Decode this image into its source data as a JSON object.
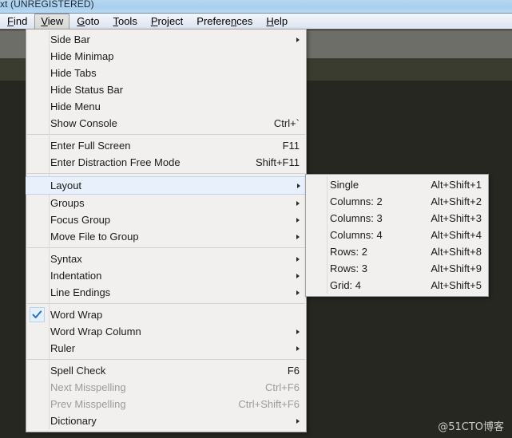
{
  "window": {
    "title": "xt (UNREGISTERED)"
  },
  "menubar": {
    "items": [
      {
        "label": "Find",
        "mnemonic": "F",
        "active": false
      },
      {
        "label": "View",
        "mnemonic": "V",
        "active": true
      },
      {
        "label": "Goto",
        "mnemonic": "G",
        "active": false
      },
      {
        "label": "Tools",
        "mnemonic": "T",
        "active": false
      },
      {
        "label": "Project",
        "mnemonic": "P",
        "active": false
      },
      {
        "label": "Preferences",
        "mnemonic": "n",
        "active": false
      },
      {
        "label": "Help",
        "mnemonic": "H",
        "active": false
      }
    ]
  },
  "view_menu": {
    "groups": [
      {
        "items": [
          {
            "label": "Side Bar",
            "shortcut": "",
            "submenu": true,
            "disabled": false,
            "checked": false,
            "highlighted": false
          },
          {
            "label": "Hide Minimap",
            "shortcut": "",
            "submenu": false,
            "disabled": false,
            "checked": false,
            "highlighted": false
          },
          {
            "label": "Hide Tabs",
            "shortcut": "",
            "submenu": false,
            "disabled": false,
            "checked": false,
            "highlighted": false
          },
          {
            "label": "Hide Status Bar",
            "shortcut": "",
            "submenu": false,
            "disabled": false,
            "checked": false,
            "highlighted": false
          },
          {
            "label": "Hide Menu",
            "shortcut": "",
            "submenu": false,
            "disabled": false,
            "checked": false,
            "highlighted": false
          },
          {
            "label": "Show Console",
            "shortcut": "Ctrl+`",
            "submenu": false,
            "disabled": false,
            "checked": false,
            "highlighted": false
          }
        ]
      },
      {
        "items": [
          {
            "label": "Enter Full Screen",
            "shortcut": "F11",
            "submenu": false,
            "disabled": false,
            "checked": false,
            "highlighted": false
          },
          {
            "label": "Enter Distraction Free Mode",
            "shortcut": "Shift+F11",
            "submenu": false,
            "disabled": false,
            "checked": false,
            "highlighted": false
          }
        ]
      },
      {
        "items": [
          {
            "label": "Layout",
            "shortcut": "",
            "submenu": true,
            "disabled": false,
            "checked": false,
            "highlighted": true
          },
          {
            "label": "Groups",
            "shortcut": "",
            "submenu": true,
            "disabled": false,
            "checked": false,
            "highlighted": false
          },
          {
            "label": "Focus Group",
            "shortcut": "",
            "submenu": true,
            "disabled": false,
            "checked": false,
            "highlighted": false
          },
          {
            "label": "Move File to Group",
            "shortcut": "",
            "submenu": true,
            "disabled": false,
            "checked": false,
            "highlighted": false
          }
        ]
      },
      {
        "items": [
          {
            "label": "Syntax",
            "shortcut": "",
            "submenu": true,
            "disabled": false,
            "checked": false,
            "highlighted": false
          },
          {
            "label": "Indentation",
            "shortcut": "",
            "submenu": true,
            "disabled": false,
            "checked": false,
            "highlighted": false
          },
          {
            "label": "Line Endings",
            "shortcut": "",
            "submenu": true,
            "disabled": false,
            "checked": false,
            "highlighted": false
          }
        ]
      },
      {
        "items": [
          {
            "label": "Word Wrap",
            "shortcut": "",
            "submenu": false,
            "disabled": false,
            "checked": true,
            "highlighted": false
          },
          {
            "label": "Word Wrap Column",
            "shortcut": "",
            "submenu": true,
            "disabled": false,
            "checked": false,
            "highlighted": false
          },
          {
            "label": "Ruler",
            "shortcut": "",
            "submenu": true,
            "disabled": false,
            "checked": false,
            "highlighted": false
          }
        ]
      },
      {
        "items": [
          {
            "label": "Spell Check",
            "shortcut": "F6",
            "submenu": false,
            "disabled": false,
            "checked": false,
            "highlighted": false
          },
          {
            "label": "Next Misspelling",
            "shortcut": "Ctrl+F6",
            "submenu": false,
            "disabled": true,
            "checked": false,
            "highlighted": false
          },
          {
            "label": "Prev Misspelling",
            "shortcut": "Ctrl+Shift+F6",
            "submenu": false,
            "disabled": true,
            "checked": false,
            "highlighted": false
          },
          {
            "label": "Dictionary",
            "shortcut": "",
            "submenu": true,
            "disabled": false,
            "checked": false,
            "highlighted": false
          }
        ]
      }
    ]
  },
  "layout_submenu": {
    "items": [
      {
        "label": "Single",
        "shortcut": "Alt+Shift+1"
      },
      {
        "label": "Columns: 2",
        "shortcut": "Alt+Shift+2"
      },
      {
        "label": "Columns: 3",
        "shortcut": "Alt+Shift+3"
      },
      {
        "label": "Columns: 4",
        "shortcut": "Alt+Shift+4"
      },
      {
        "label": "Rows: 2",
        "shortcut": "Alt+Shift+8"
      },
      {
        "label": "Rows: 3",
        "shortcut": "Alt+Shift+9"
      },
      {
        "label": "Grid: 4",
        "shortcut": "Alt+Shift+5"
      }
    ]
  },
  "watermark": {
    "text": "@51CTO博客"
  },
  "colors": {
    "titlebar": "#aed0ee",
    "menubar": "#e7ecf6",
    "toolbar": "#6d6e68",
    "tabstrip": "#3b3c30",
    "editor": "#262721",
    "menu_bg": "#f1f0ee",
    "highlight": "#e8f1fb",
    "highlight_border": "#b8d6f0",
    "check_blue": "#1f6fd0",
    "disabled_text": "#9b9b98"
  }
}
